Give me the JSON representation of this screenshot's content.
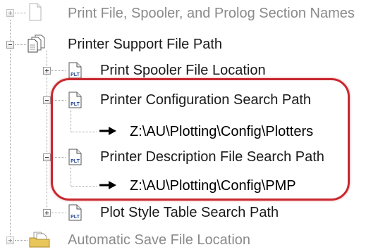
{
  "tree": {
    "items": [
      {
        "label": "Print File, Spooler, and Prolog Section Names",
        "icon": "blank-document-icon",
        "state": "collapsed"
      },
      {
        "label": "Printer Support File Path",
        "icon": "multiple-documents-icon",
        "state": "expanded"
      },
      {
        "label": "Print Spooler File Location",
        "icon": "plt-document-icon",
        "state": "collapsed"
      },
      {
        "label": "Printer Configuration Search Path",
        "icon": "plt-document-icon",
        "state": "expanded"
      },
      {
        "label": "Z:\\AU\\Plotting\\Config\\Plotters",
        "icon": "arrow-right-icon"
      },
      {
        "label": "Printer Description File Search Path",
        "icon": "plt-document-icon",
        "state": "expanded"
      },
      {
        "label": "Z:\\AU\\Plotting\\Config\\PMP",
        "icon": "arrow-right-icon"
      },
      {
        "label": "Plot Style Table Search Path",
        "icon": "plt-document-icon",
        "state": "collapsed"
      },
      {
        "label": "Automatic Save File Location",
        "icon": "folder-documents-icon",
        "state": "collapsed"
      }
    ],
    "plt_icon_text": "PLT"
  },
  "colors": {
    "highlight": "#c8282e",
    "text": "#1a1a1a",
    "faded_text": "#8a8a8a",
    "plt_blue": "#1c3f8f"
  }
}
